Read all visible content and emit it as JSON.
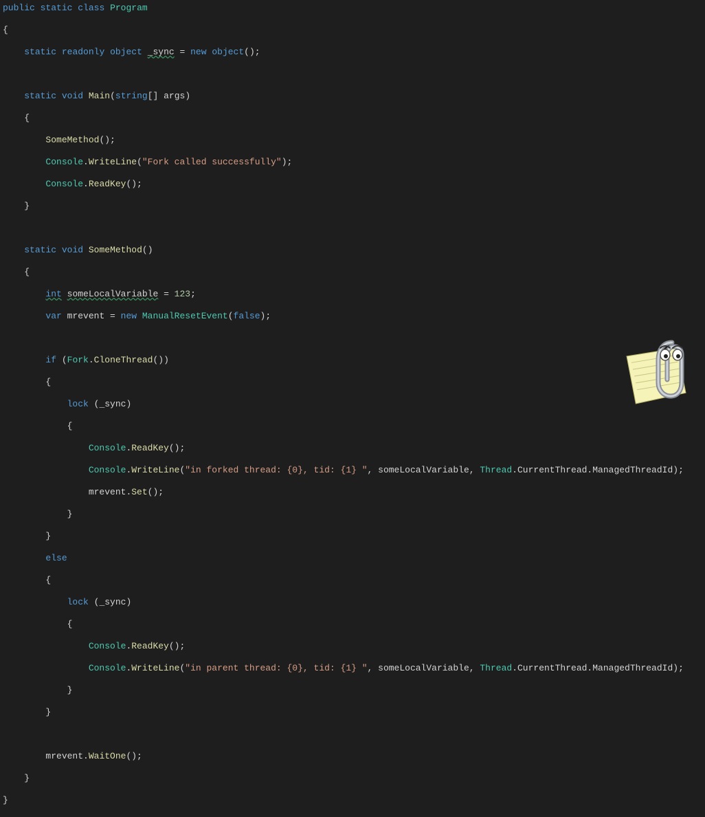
{
  "code": {
    "cls_decl": {
      "public": "public",
      "static": "static",
      "class": "class",
      "name": "Program"
    },
    "sync_decl": {
      "static": "static",
      "readonly": "readonly",
      "object": "object",
      "name": "_sync",
      "eq": " = ",
      "new": "new",
      "ctor": "object"
    },
    "main_sig": {
      "static": "static",
      "void": "void",
      "name": "Main",
      "string": "string",
      "args": "args"
    },
    "main_body": {
      "call_some": "SomeMethod",
      "wl": "WriteLine",
      "console": "Console",
      "msg": "\"Fork called successfully\"",
      "rk": "ReadKey"
    },
    "some_sig": {
      "static": "static",
      "void": "void",
      "name": "SomeMethod"
    },
    "some_body": {
      "int": "int",
      "var1": "someLocalVariable",
      "v1": "123",
      "var": "var",
      "mrevent": "mrevent",
      "new": "new",
      "mre": "ManualResetEvent",
      "false": "false",
      "if": "if",
      "fork": "Fork",
      "clone": "CloneThread",
      "lock": "lock",
      "sync": "_sync",
      "console": "Console",
      "rk": "ReadKey",
      "wl": "WriteLine",
      "msg_forked": "\"in forked thread: {0}, tid: {1} \"",
      "msg_parent": "\"in parent thread: {0}, tid: {1} \"",
      "slv": "someLocalVariable",
      "thread": "Thread",
      "ct": "CurrentThread",
      "mtid": "ManagedThreadId",
      "set": "Set",
      "else": "else",
      "waitone": "WaitOne"
    }
  },
  "assistant": {
    "name": "clippy-assistant"
  }
}
